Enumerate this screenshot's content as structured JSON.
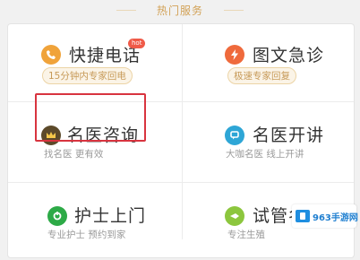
{
  "header": {
    "title": "热门服务"
  },
  "services": [
    {
      "title": "快捷电话",
      "subtitle": "15分钟内专家回电",
      "badge": "hot",
      "icon": "phone-icon",
      "icon_color": "#f0a33a"
    },
    {
      "title": "图文急诊",
      "subtitle": "极速专家回复",
      "icon": "bolt-icon",
      "icon_color": "#ef6a3c"
    },
    {
      "title": "名医咨询",
      "subtitle": "找名医 更有效",
      "icon": "crown-icon",
      "icon_color": "#5c4a2a"
    },
    {
      "title": "名医开讲",
      "subtitle": "大咖名医 线上开讲",
      "icon": "chat-icon",
      "icon_color": "#2ea6d6"
    },
    {
      "title": "护士上门",
      "subtitle": "专业护士 预约到家",
      "icon": "nurse-icon",
      "icon_color": "#2daa47"
    },
    {
      "title": "试管名",
      "subtitle": "专注生殖",
      "icon": "tube-icon",
      "icon_color": "#8cc63e"
    }
  ],
  "watermark": {
    "text": "963手游网"
  }
}
